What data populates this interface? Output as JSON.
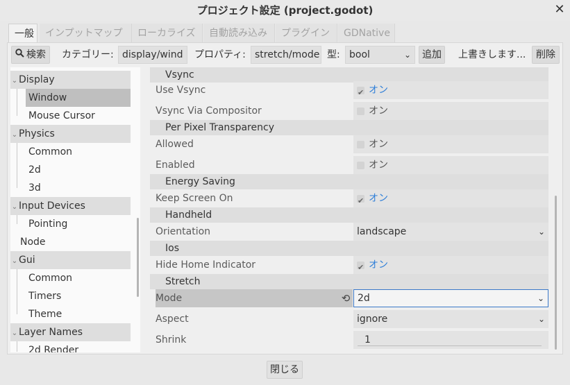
{
  "window": {
    "title": "プロジェクト設定 (project.godot)",
    "close_glyph": "✕"
  },
  "tabs": [
    {
      "label": "一般",
      "active": true
    },
    {
      "label": "インプットマップ"
    },
    {
      "label": "ローカライズ"
    },
    {
      "label": "自動読み込み"
    },
    {
      "label": "プラグイン"
    },
    {
      "label": "GDNative"
    }
  ],
  "toolbar": {
    "search_label": "検索",
    "category_label": "カテゴリー:",
    "category_value": "display/wind",
    "property_label": "プロパティ:",
    "property_value": "stretch/mode",
    "type_label": "型:",
    "type_value": "bool",
    "add_label": "追加",
    "override_label": "上書きします...",
    "delete_label": "削除"
  },
  "tree": {
    "items": [
      {
        "label": "Display",
        "section": true
      },
      {
        "label": "Window",
        "selected": true
      },
      {
        "label": "Mouse Cursor"
      },
      {
        "label": "Physics",
        "section": true
      },
      {
        "label": "Common"
      },
      {
        "label": "2d"
      },
      {
        "label": "3d"
      },
      {
        "label": "Input Devices",
        "section": true
      },
      {
        "label": "Pointing"
      },
      {
        "label": "Node",
        "section": false
      },
      {
        "label": "Gui",
        "section": true
      },
      {
        "label": "Common"
      },
      {
        "label": "Timers"
      },
      {
        "label": "Theme"
      },
      {
        "label": "Layer Names",
        "section": true
      },
      {
        "label": "2d Render"
      }
    ]
  },
  "inspector": {
    "on_text": "オン",
    "vsync_cat": "Vsync",
    "use_vsync": "Use Vsync",
    "vsync_via_compositor": "Vsync Via Compositor",
    "ppt_cat": "Per Pixel Transparency",
    "allowed": "Allowed",
    "enabled": "Enabled",
    "energy_cat": "Energy Saving",
    "keep_screen_on": "Keep Screen On",
    "handheld_cat": "Handheld",
    "orientation": "Orientation",
    "orientation_value": "landscape",
    "ios_cat": "Ios",
    "hide_home_indicator": "Hide Home Indicator",
    "stretch_cat": "Stretch",
    "mode": "Mode",
    "mode_value": "2d",
    "aspect": "Aspect",
    "aspect_value": "ignore",
    "shrink": "Shrink",
    "shrink_value": "1",
    "checked": {
      "use_vsync": true,
      "vsync_via_compositor": false,
      "allowed": false,
      "enabled": false,
      "keep_screen_on": true,
      "hide_home_indicator": true
    }
  },
  "footer": {
    "close_label": "閉じる"
  },
  "colors": {
    "accent": "#2f7fd8",
    "focus_border": "#3a78c8"
  }
}
